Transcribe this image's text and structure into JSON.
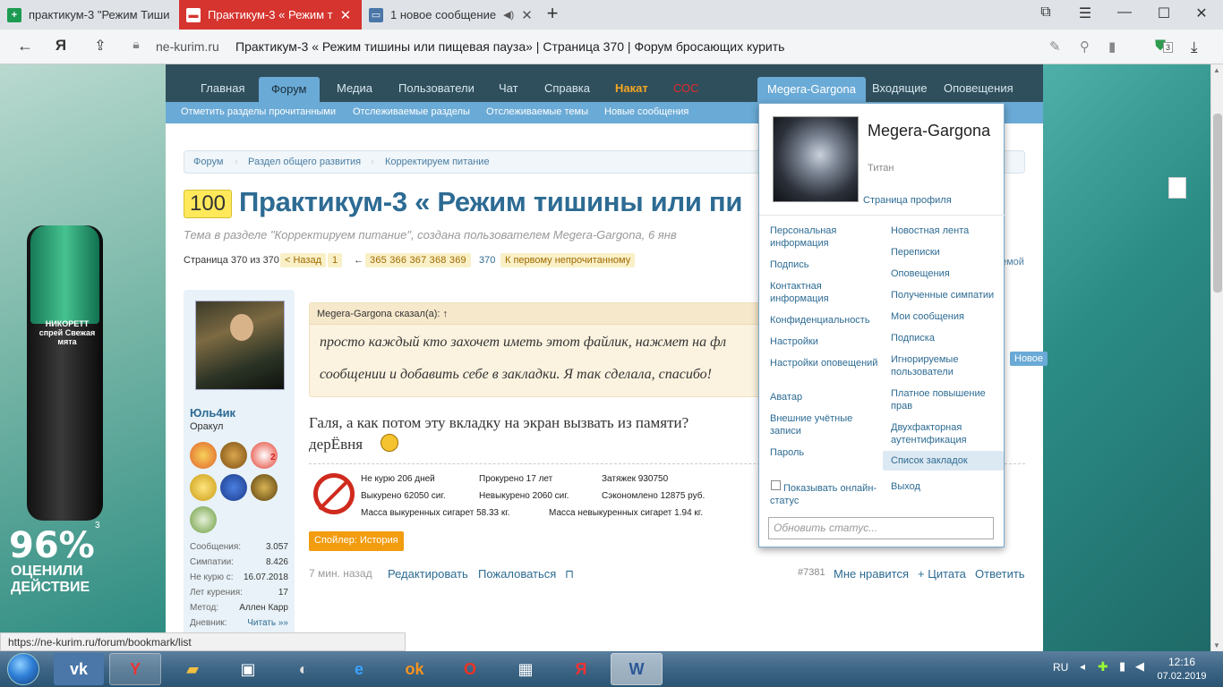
{
  "browser": {
    "tabs": [
      {
        "label": "практикум-3 \"Режим Тиши",
        "favicon": "sheets-icon"
      },
      {
        "label": "Практикум-3 « Режим т",
        "favicon": "page-icon",
        "active": true
      },
      {
        "label": "1 новое сообщение",
        "favicon": "vk-icon"
      }
    ],
    "new_tab": "+",
    "url_domain": "ne-kurim.ru",
    "url_title": "Практикум-3 « Режим тишины или пищевая пауза» | Страница 370 | Форум бросающих курить",
    "extension_badge": "3"
  },
  "ad": {
    "brand": "НИКОРЕТТ спрей Свежая мята",
    "percent": "96%",
    "claim": "ОЦЕНИЛИ ДЕЙСТВИЕ",
    "sup": "3"
  },
  "nav": {
    "main": [
      "Главная",
      "Форум",
      "Медиа",
      "Пользователи",
      "Чат",
      "Справка",
      "Накат",
      "СОС"
    ],
    "selected": "Форум",
    "user_tab": "Megera-Gargona",
    "right": [
      "Входящие",
      "Оповещения"
    ],
    "sub": [
      "Отметить разделы прочитанными",
      "Отслеживаемые разделы",
      "Отслеживаемые темы",
      "Новые сообщения"
    ]
  },
  "breadcrumb": [
    "Форум",
    "Раздел общего развития",
    "Корректируем питание"
  ],
  "thread": {
    "badge": "100",
    "title": "Практикум-3 « Режим тишины или пи",
    "desc": "Тема в разделе \"Корректируем питание\", создана пользователем Megera-Gargona, 6 янв",
    "pager": {
      "label": "Страница 370 из 370",
      "back": "< Назад",
      "first": "1",
      "arrow": "←",
      "pages": [
        "365",
        "366",
        "367",
        "368",
        "369"
      ],
      "current": "370",
      "first_unread": "К первому непрочитанному"
    },
    "watch_topic": "емой"
  },
  "post": {
    "author": "Юль4ик",
    "rank": "Оракул",
    "award_2": "2",
    "stats": [
      {
        "label": "Сообщения:",
        "value": "3.057"
      },
      {
        "label": "Симпатии:",
        "value": "8.426"
      },
      {
        "label": "Не курю с:",
        "value": "16.07.2018"
      },
      {
        "label": "Лет курения:",
        "value": "17"
      },
      {
        "label": "Метод:",
        "value": "Аллен Карр"
      },
      {
        "label": "Дневник:",
        "value": "Читать »»"
      }
    ],
    "quote_head": "Megera-Gargona сказал(а): ↑",
    "quote_lines": [
      "просто каждый кто захочет иметь этот файлик, нажмет на фл",
      "сообщении и добавить себе в закладки. Я так сделала, спасибо!"
    ],
    "text1": "Галя, а как потом эту вкладку на экран вызвать из памяти?",
    "text2": "дерЁвня",
    "signature": {
      "no_smoke": "Не курю 206 дней",
      "smoked": "Прокурено 17 лет",
      "puffs": "Затяжек 930750",
      "smoked_cigs": "Выкурено 62050 сиг.",
      "not_smoked": "Невыкурено 2060 сиг.",
      "saved": "Сэкономлено 12875 руб.",
      "mass_smoked": "Масса выкуренных сигарет 58.33 кг.",
      "mass_not": "Масса невыкуренных сигарет 1.94 кг."
    },
    "spoiler": "Спойлер: История",
    "time": "7 мин. назад",
    "edit": "Редактировать",
    "report": "Пожаловаться",
    "number": "#7381",
    "like": "Мне нравится",
    "quote": "+ Цитата",
    "reply": "Ответить"
  },
  "dropdown": {
    "name": "Megera-Gargona",
    "rank": "Титан",
    "profile_link": "Страница профиля",
    "left": [
      "Персональная информация",
      "Подпись",
      "Контактная информация",
      "Конфиденциальность",
      "Настройки",
      "Настройки оповещений",
      "Аватар",
      "Внешние учётные записи",
      "Пароль"
    ],
    "right": [
      "Новостная лента",
      "Переписки",
      "Оповещения",
      "Полученные симпатии",
      "Мои сообщения",
      "Подписка",
      "Игнорируемые пользователи",
      "Платное повышение прав",
      "Двухфакторная аутентификация",
      "Список закладок",
      "Выход"
    ],
    "show_online": "Показывать онлайн-статус",
    "status_placeholder": "Обновить статус...",
    "new_badge": "Новое"
  },
  "status_url": "https://ne-kurim.ru/forum/bookmark/list",
  "taskbar": {
    "lang": "RU",
    "time": "12:16",
    "date": "07.02.2019"
  }
}
